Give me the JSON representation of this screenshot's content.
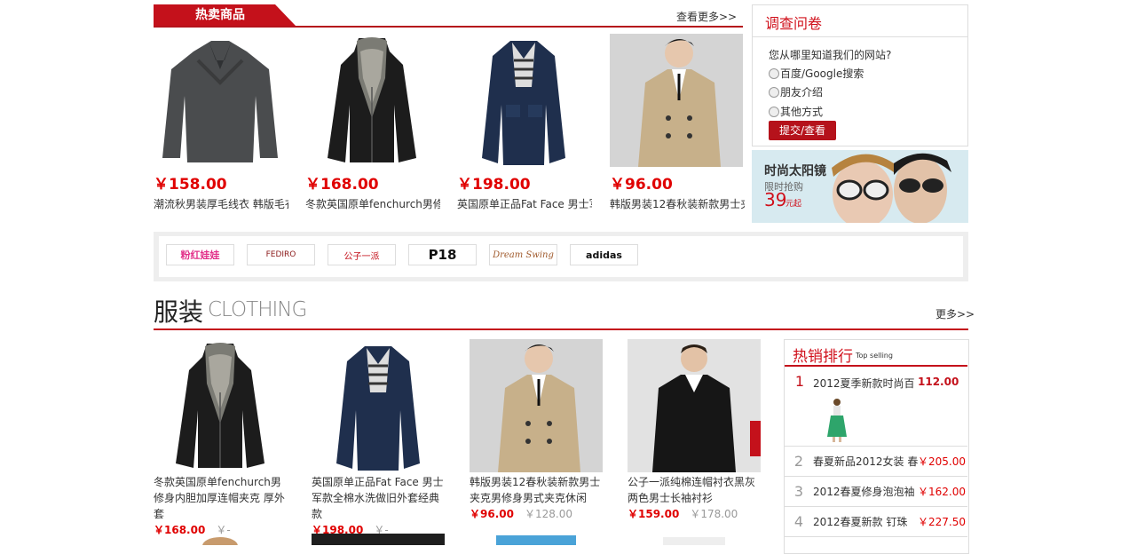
{
  "hot_sale": {
    "tab_label": "热卖商品",
    "more_label": "查看更多>>",
    "products": [
      {
        "price": "￥158.00",
        "name": "潮流秋男装厚毛线衣 韩版毛衣"
      },
      {
        "price": "￥168.00",
        "name": "冬款英国原单fenchurch男修"
      },
      {
        "price": "￥198.00",
        "name": "英国原单正品Fat Face 男士军"
      },
      {
        "price": "￥96.00",
        "name": "韩版男装12春秋装新款男士夹"
      }
    ]
  },
  "survey": {
    "title": "调查问卷",
    "question": "您从哪里知道我们的网站?",
    "options": [
      "百度/Google搜索",
      "朋友介绍",
      "其他方式"
    ],
    "submit_label": "提交/查看"
  },
  "banner": {
    "title": "时尚太阳镜",
    "subtitle": "限时抢购",
    "price": "39",
    "price_suffix": "元起"
  },
  "brands": [
    "粉红娃娃",
    "FEDIRO",
    "公子一派",
    "P18",
    "Dream Swing",
    "adidas"
  ],
  "clothing": {
    "title": "服装",
    "subtitle": "CLOTHING",
    "more_label": "更多>>",
    "products": [
      {
        "name": "冬款英国原单fenchurch男修身内胆加厚连帽夹克 厚外套",
        "price": "￥168.00",
        "old_price": "￥-"
      },
      {
        "name": "英国原单正品Fat Face 男士军款全棉水洗做旧外套经典款",
        "price": "￥198.00",
        "old_price": "￥-"
      },
      {
        "name": "韩版男装12春秋装新款男士夹克男修身男式夹克休闲",
        "price": "￥96.00",
        "old_price": "￥128.00"
      },
      {
        "name": "公子一派纯棉连帽衬衣黑灰两色男士长袖衬衫",
        "price": "￥159.00",
        "old_price": "￥178.00"
      }
    ]
  },
  "ranking": {
    "title": "热销排行",
    "subtitle": "Top selling",
    "items": [
      {
        "num": "1",
        "name": "2012夏季新款时尚百",
        "price": "112.00"
      },
      {
        "num": "2",
        "name": "春夏新品2012女装 春",
        "price": "￥205.00"
      },
      {
        "num": "3",
        "name": "2012春夏修身泡泡袖",
        "price": "￥162.00"
      },
      {
        "num": "4",
        "name": "2012春夏新款 钉珠",
        "price": "￥227.50"
      }
    ]
  }
}
